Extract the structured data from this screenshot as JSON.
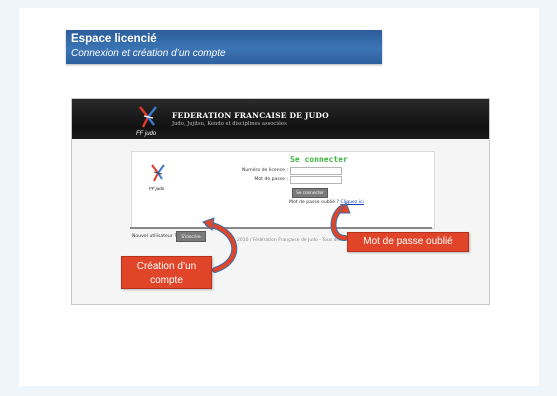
{
  "slide": {
    "title": "Espace licencié",
    "subtitle": "Connexion et création d’un compte"
  },
  "site": {
    "org_name": "FEDERATION FRANCAISE DE JUDO",
    "org_subtitle": "Judo, Jujitsu, Kendo et disciplines associées",
    "logo_text": "FF judo"
  },
  "login": {
    "heading": "Se connecter",
    "license_label": "Numéro de licence :",
    "password_label": "Mot de passe :",
    "connect_button": "Se connecter",
    "forgot_prefix": "Mot de passe oublié ?",
    "forgot_link": "Cliquez ici"
  },
  "register": {
    "new_user_label": "Nouvel utilisateur ?",
    "register_button": "S'inscrire"
  },
  "footer": {
    "text": "2010 / Fédération Française de Judo - Tous droits réservés"
  },
  "callouts": {
    "creation": "Création d’un compte",
    "forgot": "Mot de passe oublié"
  },
  "colors": {
    "banner": "#3b74b4",
    "callout": "#e0452a",
    "heading_green": "#3bb63b"
  }
}
